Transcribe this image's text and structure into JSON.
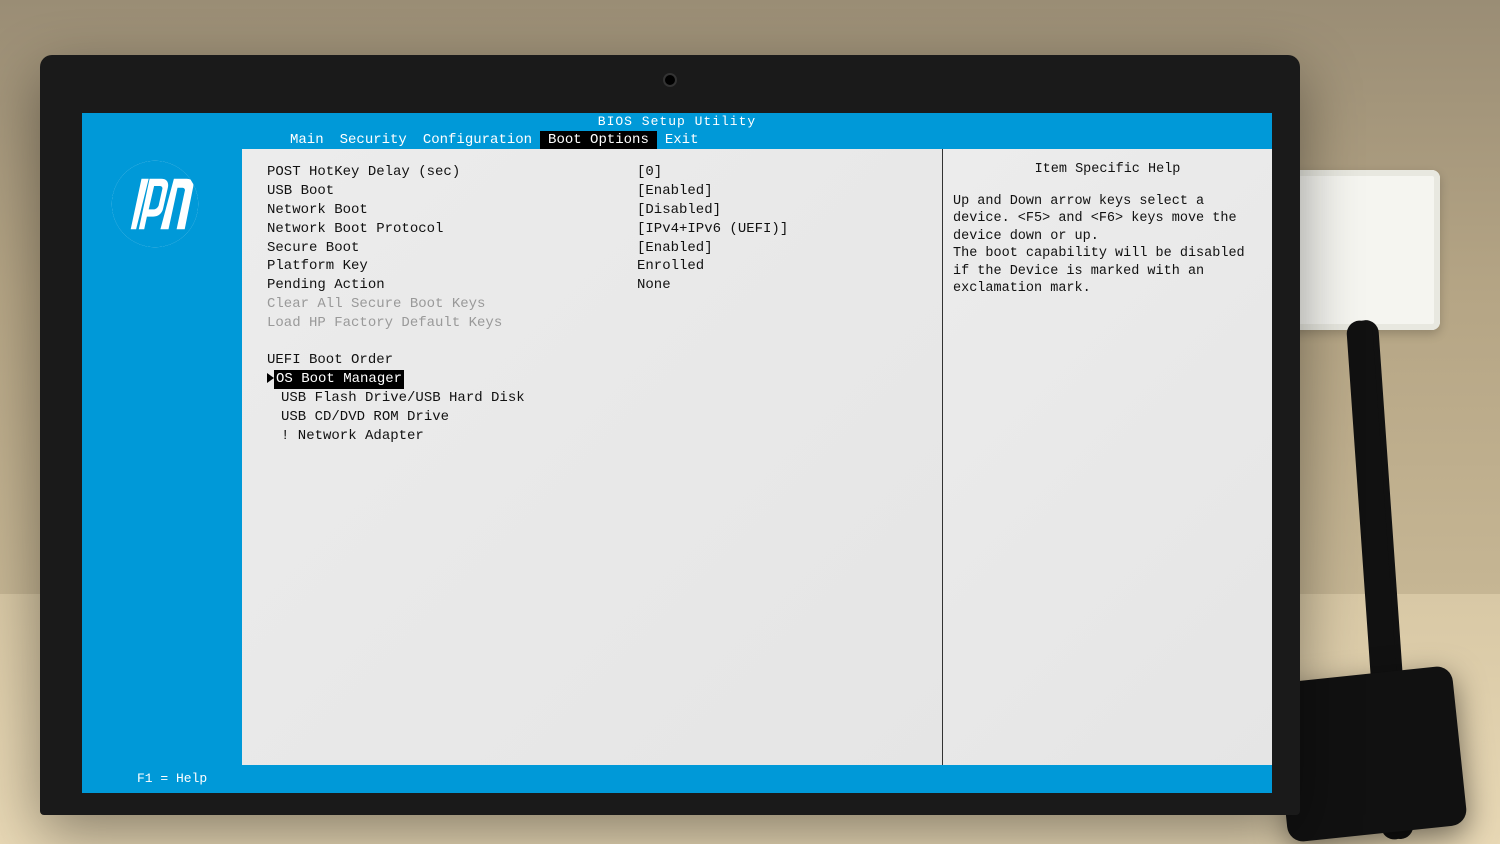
{
  "title": "BIOS Setup Utility",
  "tabs": {
    "main": "Main",
    "security": "Security",
    "configuration": "Configuration",
    "boot_options": "Boot Options",
    "exit": "Exit"
  },
  "settings": {
    "post_hotkey_delay": {
      "label": "POST HotKey Delay (sec)",
      "value": "[0]"
    },
    "usb_boot": {
      "label": "USB Boot",
      "value": "[Enabled]"
    },
    "network_boot": {
      "label": "Network Boot",
      "value": "[Disabled]"
    },
    "network_boot_protocol": {
      "label": "Network Boot Protocol",
      "value": "[IPv4+IPv6 (UEFI)]"
    },
    "secure_boot": {
      "label": "Secure Boot",
      "value": "[Enabled]"
    },
    "platform_key": {
      "label": "Platform Key",
      "value": "Enrolled"
    },
    "pending_action": {
      "label": "Pending Action",
      "value": "None"
    },
    "clear_secure_boot_keys": {
      "label": "Clear All Secure Boot Keys"
    },
    "load_hp_factory_keys": {
      "label": "Load HP Factory Default Keys"
    }
  },
  "boot_order": {
    "header": "UEFI Boot Order",
    "items": [
      "OS Boot Manager",
      "USB Flash Drive/USB Hard Disk",
      "USB CD/DVD ROM Drive",
      "! Network Adapter"
    ],
    "selected_index": 0
  },
  "help": {
    "title": "Item Specific Help",
    "body": "Up and Down arrow keys select a device. <F5> and <F6> keys move the device down or up.\nThe boot capability will be disabled if the Device is marked with an exclamation mark."
  },
  "footer": {
    "help_hint": "F1 = Help"
  }
}
